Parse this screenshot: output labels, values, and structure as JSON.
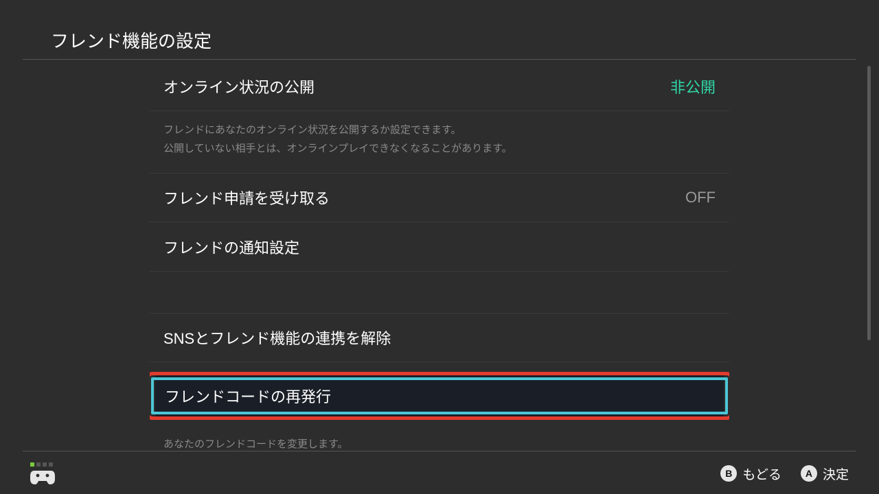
{
  "header": {
    "title": "フレンド機能の設定"
  },
  "items": {
    "online_status": {
      "label": "オンライン状況の公開",
      "value": "非公開",
      "desc1": "フレンドにあなたのオンライン状況を公開するか設定できます。",
      "desc2": "公開していない相手とは、オンラインプレイできなくなることがあります。"
    },
    "friend_request": {
      "label": "フレンド申請を受け取る",
      "value": "OFF"
    },
    "friend_notify": {
      "label": "フレンドの通知設定"
    },
    "sns_unlink": {
      "label": "SNSとフレンド機能の連携を解除"
    },
    "reissue_code": {
      "label": "フレンドコードの再発行",
      "desc": "あなたのフレンドコードを変更します。"
    }
  },
  "footer": {
    "b": {
      "glyph": "B",
      "label": "もどる"
    },
    "a": {
      "glyph": "A",
      "label": "決定"
    }
  }
}
